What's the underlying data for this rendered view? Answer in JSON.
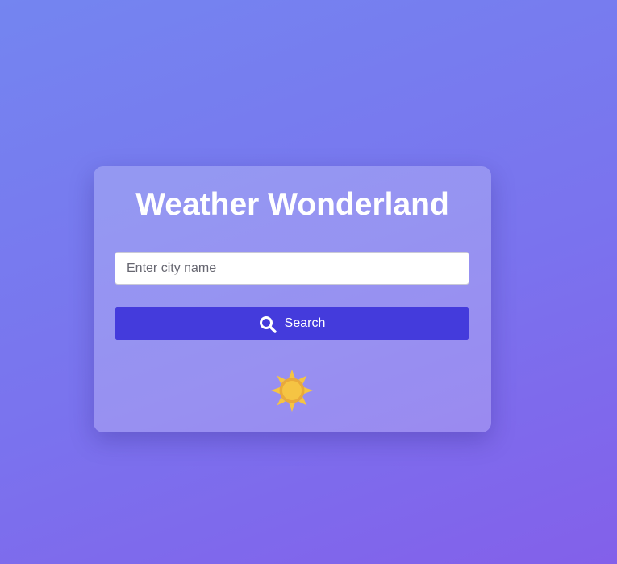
{
  "app": {
    "title": "Weather Wonderland"
  },
  "search": {
    "placeholder": "Enter city name",
    "value": "",
    "button_label": "Search",
    "button_icon": "search-icon"
  },
  "weather": {
    "icon": "sun-icon"
  },
  "colors": {
    "accent": "#443bdc",
    "sun": "#f5c443",
    "background_start": "#7485f0",
    "background_end": "#8360ea"
  }
}
